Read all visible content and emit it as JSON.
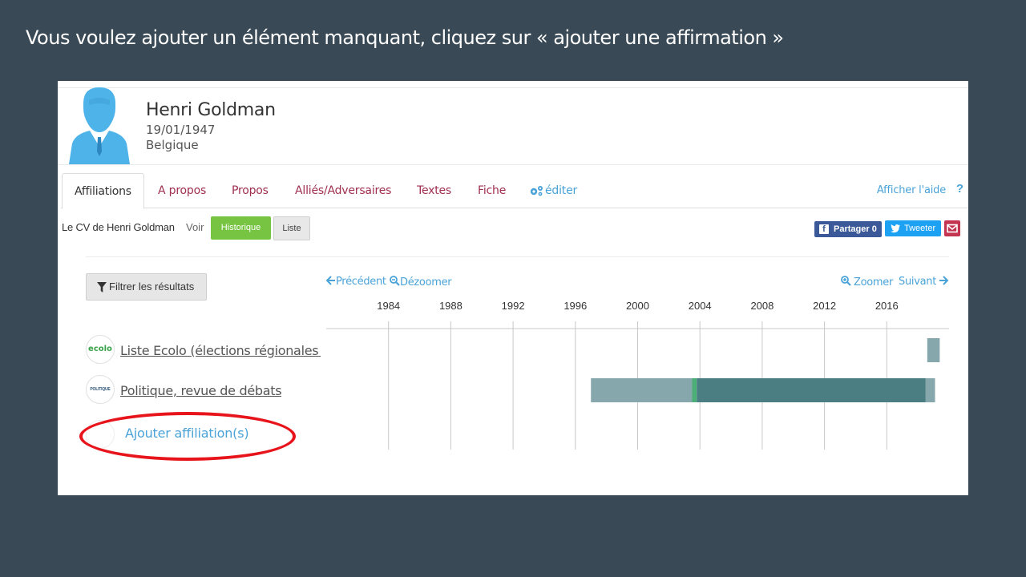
{
  "slide": {
    "title": "Vous voulez ajouter un élément manquant, cliquez sur « ajouter une affirmation »"
  },
  "profile": {
    "name": "Henri Goldman",
    "birthdate": "19/01/1947",
    "country": "Belgique"
  },
  "tabs": [
    {
      "label": "Affiliations",
      "active": true
    },
    {
      "label": "A propos"
    },
    {
      "label": "Propos"
    },
    {
      "label": "Alliés/Adversaires"
    },
    {
      "label": "Textes"
    },
    {
      "label": "Fiche"
    },
    {
      "label": "éditer",
      "icon": "gears-icon"
    }
  ],
  "help": {
    "label": "Afficher l'aide",
    "icon": "question-icon"
  },
  "toolbar": {
    "cv_label": "Le CV de Henri Goldman",
    "voir_label": "Voir",
    "historique_label": "Historique",
    "liste_label": "Liste",
    "share_label": "Partager",
    "share_count": "0",
    "tweet_label": "Tweeter",
    "mail_icon": "envelope-icon"
  },
  "filter": {
    "label": "Filtrer les résultats",
    "icon": "funnel-icon"
  },
  "timeline_nav": {
    "prev_label": "Précédent",
    "dezoom_label": "Dézoomer",
    "zoom_label": "Zoomer",
    "next_label": "Suivant"
  },
  "chart_data": {
    "type": "timeline",
    "x_ticks": [
      "1984",
      "1988",
      "1992",
      "1996",
      "2000",
      "2004",
      "2008",
      "2012",
      "2016"
    ],
    "x_range": [
      1980.0,
      2020.0
    ],
    "rows": [
      {
        "name": "Liste Ecolo (élections régionales l",
        "logo_text": "ecolo",
        "bars": [
          {
            "start": 2018.6,
            "end": 2019.4,
            "color": "#86a8ad"
          }
        ]
      },
      {
        "name": "Politique, revue de débats",
        "logo_text": "POLITIQUE",
        "bars": [
          {
            "start": 1997.0,
            "end": 2003.5,
            "color": "#86a8ad"
          },
          {
            "start": 2003.5,
            "end": 2003.8,
            "color": "#4caf78"
          },
          {
            "start": 2003.8,
            "end": 2018.5,
            "color": "#4a7e82"
          },
          {
            "start": 2018.5,
            "end": 2019.1,
            "color": "#86a8ad"
          }
        ]
      }
    ]
  },
  "add_affiliation": {
    "label": "Ajouter affiliation(s)"
  }
}
